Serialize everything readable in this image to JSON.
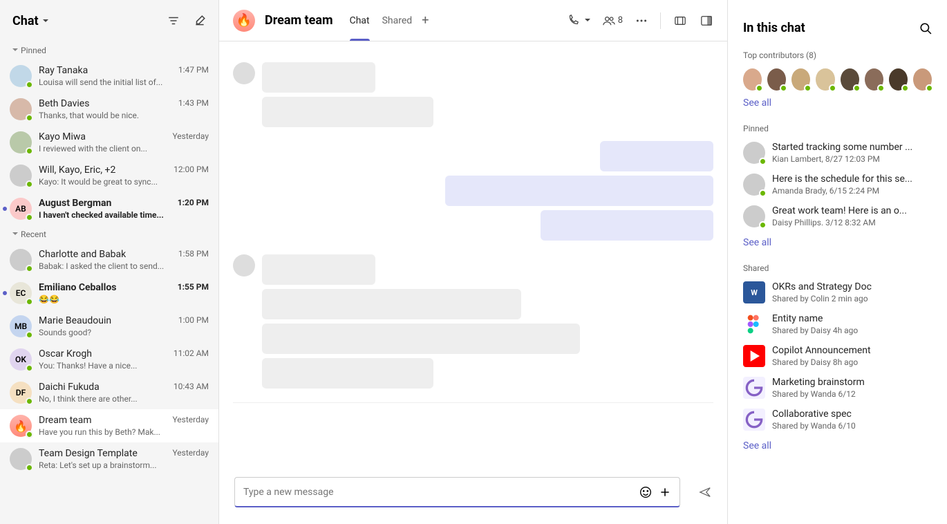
{
  "sidebar": {
    "title": "Chat",
    "sections": {
      "pinned_label": "Pinned",
      "recent_label": "Recent"
    },
    "pinned": [
      {
        "name": "Ray Tanaka",
        "time": "1:47 PM",
        "preview": "Louisa will send the initial list of...",
        "initials": "",
        "color": "#c1d8e8"
      },
      {
        "name": "Beth Davies",
        "time": "1:43 PM",
        "preview": "Thanks, that would be nice.",
        "initials": "",
        "color": "#d7b9a9"
      },
      {
        "name": "Kayo Miwa",
        "time": "Yesterday",
        "preview": "I reviewed with the client on...",
        "initials": "",
        "color": "#b9c9a9"
      },
      {
        "name": "Will, Kayo, Eric, +2",
        "time": "12:00 PM",
        "preview": "Kayo: It would be great to sync...",
        "initials": "",
        "color": "#ccc"
      },
      {
        "name": "August Bergman",
        "time": "1:20 PM",
        "preview": "I haven't checked available time...",
        "initials": "AB",
        "color": "#fbc9c9",
        "unread": true
      }
    ],
    "recent": [
      {
        "name": "Charlotte and Babak",
        "time": "1:58 PM",
        "preview": "Babak: I asked the client to send...",
        "initials": "",
        "color": "#ccc"
      },
      {
        "name": "Emiliano Ceballos",
        "time": "1:55 PM",
        "preview": "😂😂",
        "initials": "EC",
        "color": "#e8e6d9",
        "unread": true
      },
      {
        "name": "Marie Beaudouin",
        "time": "1:00 PM",
        "preview": "Sounds good?",
        "initials": "MB",
        "color": "#c4d5ef"
      },
      {
        "name": "Oscar Krogh",
        "time": "11:02 AM",
        "preview": "You: Thanks! Have a nice...",
        "initials": "OK",
        "color": "#e0d4ef"
      },
      {
        "name": "Daichi Fukuda",
        "time": "10:43 AM",
        "preview": "No, I think there are other...",
        "initials": "DF",
        "color": "#f5e0c1"
      },
      {
        "name": "Dream team",
        "time": "Yesterday",
        "preview": "Have you run this by Beth? Mak...",
        "initials": "🔥",
        "color": "fire",
        "active": true
      },
      {
        "name": "Team Design Template",
        "time": "Yesterday",
        "preview": "Reta: Let's set up a brainstorm...",
        "initials": "",
        "color": "#ccc"
      }
    ]
  },
  "main": {
    "title": "Dream team",
    "avatar_emoji": "🔥",
    "tabs": [
      {
        "label": "Chat",
        "active": true
      },
      {
        "label": "Shared",
        "active": false
      }
    ],
    "participant_count": "8",
    "message_groups": [
      {
        "own": false,
        "widths": [
          164,
          248
        ]
      },
      {
        "own": true,
        "widths": [
          164,
          388,
          250
        ]
      },
      {
        "own": false,
        "widths": [
          164,
          375,
          460,
          248
        ]
      }
    ],
    "compose_placeholder": "Type a new message"
  },
  "right": {
    "title": "In this chat",
    "contributors_label": "Top contributors (8)",
    "contributor_colors": [
      "#d9a98c",
      "#7a5c4a",
      "#c9a97a",
      "#d9c39a",
      "#5a4a3a",
      "#8a6c5a",
      "#4a3a2a",
      "#c9997a"
    ],
    "see_all": "See all",
    "pinned_label": "Pinned",
    "pinned": [
      {
        "title": "Started tracking some number ...",
        "sub": "Kian Lambert, 8/27 12:03 PM"
      },
      {
        "title": "Here is the schedule for this se...",
        "sub": "Amanda Brady, 6/15 2:24 PM"
      },
      {
        "title": "Great work team! Here is an o...",
        "sub": "Daisy Phillips. 3/12 8:32 AM"
      }
    ],
    "shared_label": "Shared",
    "shared": [
      {
        "icon": "word",
        "title": "OKRs and Strategy Doc",
        "sub": "Shared by Colin 2 min ago"
      },
      {
        "icon": "figma",
        "title": "Entity name",
        "sub": "Shared by Daisy 4h ago"
      },
      {
        "icon": "youtube",
        "title": "Copilot Announcement",
        "sub": "Shared by Daisy 8h ago"
      },
      {
        "icon": "loop",
        "title": "Marketing brainstorm",
        "sub": "Shared by Wanda 6/12"
      },
      {
        "icon": "loop",
        "title": "Collaborative spec",
        "sub": "Shared by Wanda 6/10"
      }
    ]
  }
}
